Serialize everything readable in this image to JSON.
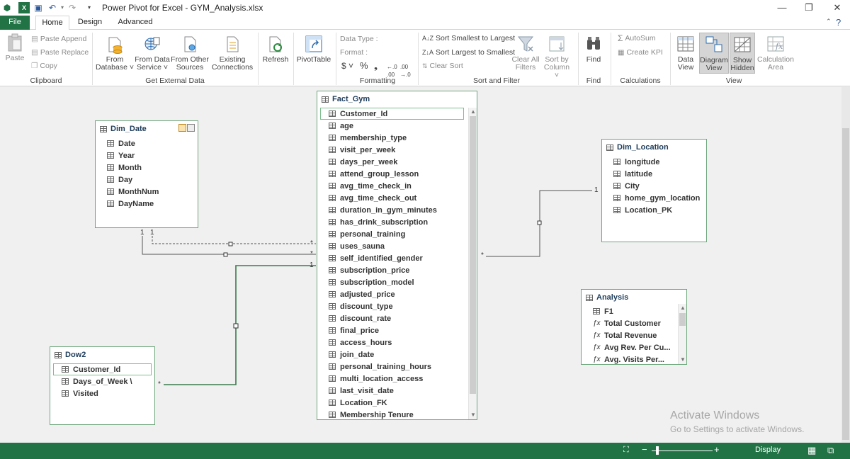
{
  "window": {
    "title": "Power Pivot for Excel - GYM_Analysis.xlsx",
    "minimize": "—",
    "restore": "❐",
    "close": "✕"
  },
  "tabs": [
    "File",
    "Home",
    "Design",
    "Advanced"
  ],
  "ribbon": {
    "clipboard": {
      "label": "Clipboard",
      "paste": "Paste",
      "paste_append": "Paste Append",
      "paste_replace": "Paste Replace",
      "copy": "Copy"
    },
    "external": {
      "label": "Get External Data",
      "from_database": [
        "From",
        "Database ˅"
      ],
      "from_data_service": [
        "From Data",
        "Service ˅"
      ],
      "from_other_sources": [
        "From Other",
        "Sources"
      ],
      "existing_connections": [
        "Existing",
        "Connections"
      ]
    },
    "refresh": "Refresh",
    "pivottable": "PivotTable",
    "formatting": {
      "label": "Formatting",
      "data_type": "Data Type :",
      "format": "Format :",
      "currency": "$ ˅",
      "percent": "%",
      "comma": "❟"
    },
    "sort_filter": {
      "label": "Sort and Filter",
      "sort_smallest": "Sort Smallest to Largest",
      "sort_largest": "Sort Largest to Smallest",
      "clear_sort": "Clear Sort",
      "clear_all_filters": [
        "Clear All",
        "Filters"
      ],
      "sort_by_column": [
        "Sort by",
        "Column ˅"
      ]
    },
    "find": {
      "label": "Find",
      "button": "Find"
    },
    "calculations": {
      "label": "Calculations",
      "autosum": "AutoSum",
      "create_kpi": "Create KPI"
    },
    "view": {
      "label": "View",
      "data_view": [
        "Data",
        "View"
      ],
      "diagram_view": [
        "Diagram",
        "View"
      ],
      "show_hidden": [
        "Show",
        "Hidden"
      ],
      "calculation_area": [
        "Calculation",
        "Area"
      ]
    }
  },
  "tables": {
    "dim_date": {
      "title": "Dim_Date",
      "columns": [
        "Date",
        "Year",
        "Month",
        "Day",
        "MonthNum",
        "DayName"
      ]
    },
    "fact_gym": {
      "title": "Fact_Gym",
      "columns": [
        "Customer_Id",
        "age",
        "membership_type",
        "visit_per_week",
        "days_per_week",
        "attend_group_lesson",
        "avg_time_check_in",
        "avg_time_check_out",
        "duration_in_gym_minutes",
        "has_drink_subscription",
        "personal_training",
        "uses_sauna",
        "self_identified_gender",
        "subscription_price",
        "subscription_model",
        "adjusted_price",
        "discount_type",
        "discount_rate",
        "final_price",
        "access_hours",
        "join_date",
        "personal_training_hours",
        "multi_location_access",
        "last_visit_date",
        "Location_FK",
        "Membership Tenure"
      ]
    },
    "dim_location": {
      "title": "Dim_Location",
      "columns": [
        "longitude",
        "latitude",
        "City",
        "home_gym_location",
        "Location_PK"
      ]
    },
    "analysis": {
      "title": "Analysis",
      "columns": [
        "F1"
      ],
      "measures": [
        "Total Customer",
        "Total Revenue",
        "Avg Rev. Per Cu...",
        "Avg. Visits Per..."
      ]
    },
    "dow2": {
      "title": "Dow2",
      "columns": [
        "Customer_Id",
        "Days_of_Week \\",
        "Visited"
      ]
    }
  },
  "cardinality": {
    "date_one_a": "1",
    "date_one_b": "1",
    "fact_many_a": "*",
    "fact_many_b": "*",
    "fact_one": "1",
    "fact_many_loc": "*",
    "loc_one": "1",
    "dow_many": "*"
  },
  "watermark": {
    "line1": "Activate Windows",
    "line2": "Go to Settings to activate Windows."
  },
  "status": {
    "display": "Display"
  },
  "colors": {
    "accent": "#217346",
    "table_border": "#6ea67c",
    "relation": "#3b7a4d"
  }
}
